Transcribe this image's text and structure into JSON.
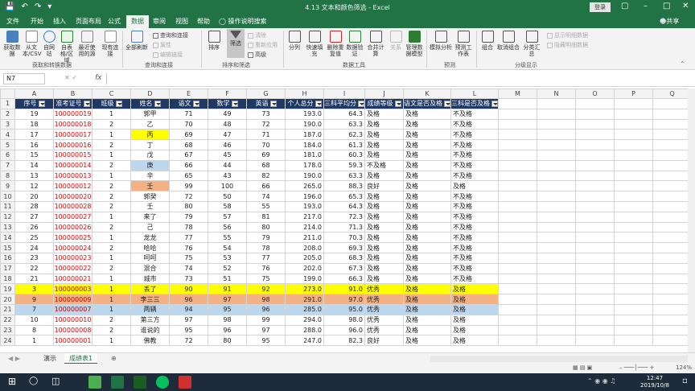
{
  "window": {
    "title": "4.13 文本和颜色筛选 - Excel",
    "login": "登录",
    "share": "共享"
  },
  "tabs": [
    "文件",
    "开始",
    "插入",
    "页面布局",
    "公式",
    "数据",
    "审阅",
    "视图",
    "帮助",
    "操作说明搜索"
  ],
  "ribbon": {
    "get_data": "获取数据",
    "from_text": "从文本/CSV",
    "from_web": "自网站",
    "from_table": "自表格/区域",
    "recent": "最近使用的源",
    "existing": "现有连接",
    "refresh_all": "全部刷新",
    "queries_connections": "查询和连接",
    "properties": "属性",
    "edit_links": "编辑链接",
    "sort": "排序",
    "filter": "筛选",
    "clear": "清除",
    "reapply": "重新应用",
    "advanced": "高级",
    "split": "分列",
    "flash_fill": "快速填充",
    "remove_dup": "删除重复值",
    "validation": "数据验证",
    "consolidate": "合并计算",
    "relationships": "关系",
    "data_model": "管理数据模型",
    "whatif": "模拟分析",
    "forecast": "预测工作表",
    "group": "组合",
    "ungroup": "取消组合",
    "subtotal": "分类汇总",
    "show_detail": "显示明细数据",
    "hide_detail": "隐藏明细数据",
    "grp_get": "获取和转换数据",
    "grp_query": "查询和连接",
    "grp_sort": "排序和筛选",
    "grp_tools": "数据工具",
    "grp_forecast": "预测",
    "grp_outline": "分级显示"
  },
  "formula_bar": {
    "name_box": "N7",
    "fx": "fx"
  },
  "columns": [
    "A",
    "B",
    "C",
    "D",
    "E",
    "F",
    "G",
    "H",
    "I",
    "J",
    "K",
    "L",
    "M",
    "N",
    "O",
    "P",
    "Q"
  ],
  "headers": [
    "序号",
    "准考证号",
    "班级",
    "姓名",
    "语文",
    "数学",
    "英语",
    "个人总分",
    "三科平均分",
    "成绩等级",
    "语文是否及格",
    "三科是否及格"
  ],
  "rows": [
    {
      "r": "2",
      "cells": [
        "19",
        "100000019",
        "1",
        "郭甲",
        "71",
        "49",
        "73",
        "193.0",
        "64.3",
        "及格",
        "及格",
        "不及格"
      ]
    },
    {
      "r": "3",
      "cells": [
        "18",
        "100000018",
        "2",
        "乙",
        "70",
        "48",
        "72",
        "190.0",
        "63.3",
        "及格",
        "及格",
        "不及格"
      ]
    },
    {
      "r": "4",
      "cells": [
        "17",
        "100000017",
        "1",
        "丙",
        "69",
        "47",
        "71",
        "187.0",
        "62.3",
        "及格",
        "及格",
        "不及格"
      ]
    },
    {
      "r": "5",
      "cells": [
        "16",
        "100000016",
        "2",
        "丁",
        "68",
        "46",
        "70",
        "184.0",
        "61.3",
        "及格",
        "及格",
        "不及格"
      ]
    },
    {
      "r": "6",
      "cells": [
        "15",
        "100000015",
        "1",
        "戊",
        "67",
        "45",
        "69",
        "181.0",
        "60.3",
        "及格",
        "及格",
        "不及格"
      ]
    },
    {
      "r": "7",
      "cells": [
        "14",
        "100000014",
        "2",
        "庚",
        "66",
        "44",
        "68",
        "178.0",
        "59.3",
        "不及格",
        "及格",
        "不及格"
      ]
    },
    {
      "r": "8",
      "cells": [
        "13",
        "100000013",
        "1",
        "辛",
        "65",
        "43",
        "82",
        "190.0",
        "63.3",
        "及格",
        "及格",
        "不及格"
      ]
    },
    {
      "r": "9",
      "cells": [
        "12",
        "100000012",
        "2",
        "壬",
        "99",
        "100",
        "66",
        "265.0",
        "88.3",
        "良好",
        "及格",
        "及格"
      ]
    },
    {
      "r": "10",
      "cells": [
        "20",
        "100000020",
        "2",
        "郭癸",
        "72",
        "50",
        "74",
        "196.0",
        "65.3",
        "及格",
        "及格",
        "不及格"
      ]
    },
    {
      "r": "11",
      "cells": [
        "28",
        "100000028",
        "2",
        "壬",
        "80",
        "58",
        "55",
        "193.0",
        "64.3",
        "及格",
        "及格",
        "不及格"
      ]
    },
    {
      "r": "12",
      "cells": [
        "27",
        "100000027",
        "1",
        "来了",
        "79",
        "57",
        "81",
        "217.0",
        "72.3",
        "及格",
        "及格",
        "不及格"
      ]
    },
    {
      "r": "13",
      "cells": [
        "26",
        "100000026",
        "2",
        "己",
        "78",
        "56",
        "80",
        "214.0",
        "71.3",
        "及格",
        "及格",
        "不及格"
      ]
    },
    {
      "r": "14",
      "cells": [
        "25",
        "100000025",
        "1",
        "龙龙",
        "77",
        "55",
        "79",
        "211.0",
        "70.3",
        "及格",
        "及格",
        "不及格"
      ]
    },
    {
      "r": "15",
      "cells": [
        "24",
        "100000024",
        "2",
        "哈哈",
        "76",
        "54",
        "78",
        "208.0",
        "69.3",
        "及格",
        "及格",
        "不及格"
      ]
    },
    {
      "r": "16",
      "cells": [
        "23",
        "100000023",
        "1",
        "呵呵",
        "75",
        "53",
        "77",
        "205.0",
        "68.3",
        "及格",
        "及格",
        "不及格"
      ]
    },
    {
      "r": "17",
      "cells": [
        "22",
        "100000022",
        "2",
        "混合",
        "74",
        "52",
        "76",
        "202.0",
        "67.3",
        "及格",
        "及格",
        "不及格"
      ]
    },
    {
      "r": "18",
      "cells": [
        "21",
        "100000021",
        "1",
        "城市",
        "73",
        "51",
        "75",
        "199.0",
        "66.3",
        "及格",
        "及格",
        "不及格"
      ]
    },
    {
      "r": "19",
      "cells": [
        "3",
        "100000003",
        "1",
        "丢了",
        "90",
        "91",
        "92",
        "273.0",
        "91.0",
        "优秀",
        "及格",
        "及格"
      ]
    },
    {
      "r": "20",
      "cells": [
        "9",
        "100000009",
        "1",
        "李三三",
        "96",
        "97",
        "98",
        "291.0",
        "97.0",
        "优秀",
        "及格",
        "及格"
      ]
    },
    {
      "r": "21",
      "cells": [
        "7",
        "100000007",
        "1",
        "两辆",
        "94",
        "95",
        "96",
        "285.0",
        "95.0",
        "优秀",
        "及格",
        "及格"
      ]
    },
    {
      "r": "22",
      "cells": [
        "10",
        "100000010",
        "2",
        "第三方",
        "97",
        "98",
        "99",
        "294.0",
        "98.0",
        "优秀",
        "及格",
        "及格"
      ]
    },
    {
      "r": "23",
      "cells": [
        "8",
        "100000008",
        "2",
        "谁说的",
        "95",
        "96",
        "97",
        "288.0",
        "96.0",
        "优秀",
        "及格",
        "及格"
      ]
    },
    {
      "r": "24",
      "cells": [
        "1",
        "100000001",
        "1",
        "佛教",
        "72",
        "80",
        "95",
        "247.0",
        "82.3",
        "良好",
        "及格",
        "及格"
      ]
    }
  ],
  "colors": {
    "excel_green": "#217346",
    "header_navy": "#1f3864",
    "yellow": "#ffff00",
    "orange": "#f4b183",
    "blue": "#bdd7ee",
    "id_red": "#e00000"
  },
  "sheets": [
    "演示",
    "成绩表1"
  ],
  "status": {
    "zoom": "124%"
  },
  "taskbar": {
    "time": "12:47",
    "date": "2019/10/8"
  }
}
